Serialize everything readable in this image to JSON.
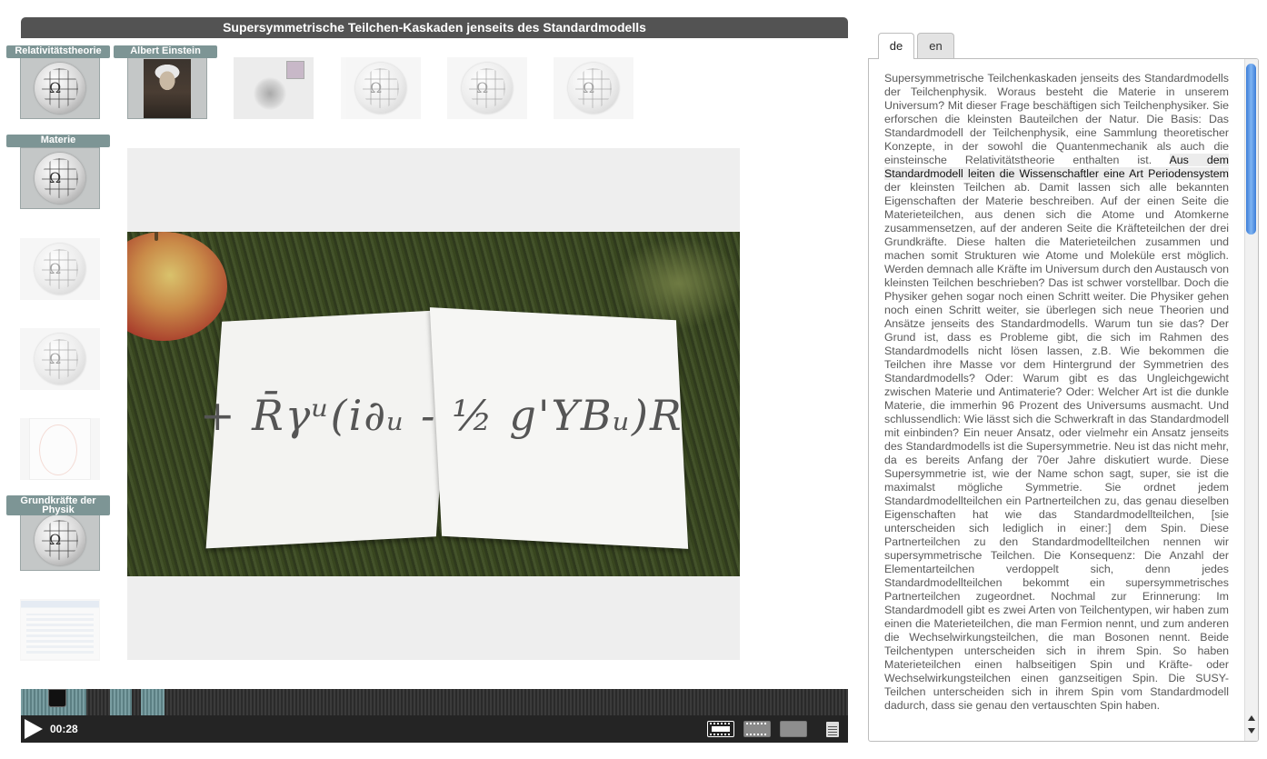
{
  "player": {
    "title": "Supersymmetrische Teilchen-Kaskaden jenseits des Standardmodells",
    "time": "00:28",
    "video_formula": "+ R̄γᵘ(i∂ᵤ - ½ g'YBᵤ)R"
  },
  "thumbs": [
    {
      "label": "Relativitätstheorie",
      "icon": "wikipedia-globe"
    },
    {
      "label": "Albert Einstein",
      "icon": "einstein-portrait"
    },
    {
      "label": "Materie",
      "icon": "wikipedia-globe"
    },
    {
      "label": "Grundkräfte der Physik",
      "icon": "wikipedia-globe"
    }
  ],
  "tabs": [
    {
      "label": "de",
      "active": true
    },
    {
      "label": "en",
      "active": false
    }
  ],
  "transcript": {
    "before": "Supersymmetrische Teilchenkaskaden jenseits des Standardmodells der Teilchenphysik. Woraus besteht die Materie in unserem Universum? Mit dieser Frage beschäftigen sich Teilchenphysiker. Sie erforschen die kleinsten Bauteilchen der Natur. Die Basis: Das Standardmodell der Teilchenphysik, eine Sammlung theoretischer Konzepte, in der sowohl die Quantenmechanik als auch die einsteinsche Relativitätstheorie enthalten ist. ",
    "highlight": "Aus dem Standardmodell leiten die Wissenschaftler eine Art Periodensystem",
    "after": " der kleinsten Teilchen ab. Damit lassen sich alle bekannten Eigenschaften der Materie beschreiben. Auf der einen Seite die Materieteilchen, aus denen sich die Atome und Atomkerne zusammensetzen, auf der anderen Seite die Kräfteteilchen der drei Grundkräfte. Diese halten die Materieteilchen zusammen und machen somit Strukturen wie Atome und Moleküle erst möglich. Werden demnach alle Kräfte im Universum durch den Austausch von kleinsten Teilchen beschrieben? Das ist schwer vorstellbar. Doch die Physiker gehen sogar noch einen Schritt weiter. Die Physiker gehen noch einen Schritt weiter, sie überlegen sich neue Theorien und Ansätze jenseits des Standardmodells. Warum tun sie das? Der Grund ist, dass es Probleme gibt, die sich im Rahmen des Standardmodells nicht lösen lassen, z.B. Wie bekommen die Teilchen ihre Masse vor dem Hintergrund der Symmetrien des Standardmodells? Oder: Warum gibt es das Ungleichgewicht zwischen Materie und Antimaterie? Oder: Welcher Art ist die dunkle Materie, die immerhin 96 Prozent des Universums ausmacht. Und schlussendlich: Wie lässt sich die Schwerkraft in das Standardmodell mit einbinden? Ein neuer Ansatz, oder vielmehr ein Ansatz jenseits des Standardmodells ist die Supersymmetrie. Neu ist das nicht mehr, da es bereits Anfang der 70er Jahre diskutiert wurde. Diese Supersymmetrie ist, wie der Name schon sagt, super, sie ist die maximalst mögliche Symmetrie. Sie ordnet jedem Standardmodellteilchen ein Partnerteilchen zu, das genau dieselben Eigenschaften hat wie das Standardmodellteilchen, [sie unterscheiden sich lediglich in einer:] dem Spin. Diese Partnerteilchen zu den Standardmodellteilchen nennen wir supersymmetrische Teilchen. Die Konsequenz: Die Anzahl der Elementarteilchen verdoppelt sich, denn jedes Standardmodellteilchen bekommt ein supersymmetrisches Partnerteilchen zugeordnet. Nochmal zur Erinnerung: Im Standardmodell gibt es zwei Arten von Teilchentypen, wir haben zum einen die Materieteilchen, die man Fermion nennt, und zum anderen die Wechselwirkungsteilchen, die man Bosonen nennt. Beide Teilchentypen unterscheiden sich in ihrem Spin. So haben Materieteilchen einen halbseitigen Spin und Kräfte- oder Wechselwirkungsteilchen einen ganzseitigen Spin. Die SUSY-Teilchen unterscheiden sich in ihrem Spin vom Standardmodell dadurch, dass sie genau den vertauschten Spin haben."
  },
  "colors": {
    "title_bar": "#535353",
    "label_bg": "#7d9595",
    "timeline_progress": "#7a9ea2",
    "scroll_thumb": "#3d7ed8"
  }
}
